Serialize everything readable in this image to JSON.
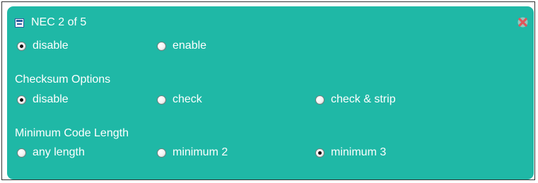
{
  "panel": {
    "title": "NEC 2 of 5",
    "collapse_icon": "collapse-icon",
    "close_icon": "close-x-icon",
    "accent_color": "#1fb8a6",
    "close_color": "#e0565b"
  },
  "mode": {
    "options": [
      {
        "label": "disable",
        "checked": true
      },
      {
        "label": "enable",
        "checked": false
      }
    ]
  },
  "checksum": {
    "label": "Checksum Options",
    "options": [
      {
        "label": "disable",
        "checked": true
      },
      {
        "label": "check",
        "checked": false
      },
      {
        "label": "check & strip",
        "checked": false
      }
    ]
  },
  "min_length": {
    "label": "Minimum Code Length",
    "options": [
      {
        "label": "any length",
        "checked": false
      },
      {
        "label": "minimum 2",
        "checked": false
      },
      {
        "label": "minimum 3",
        "checked": true
      }
    ]
  }
}
